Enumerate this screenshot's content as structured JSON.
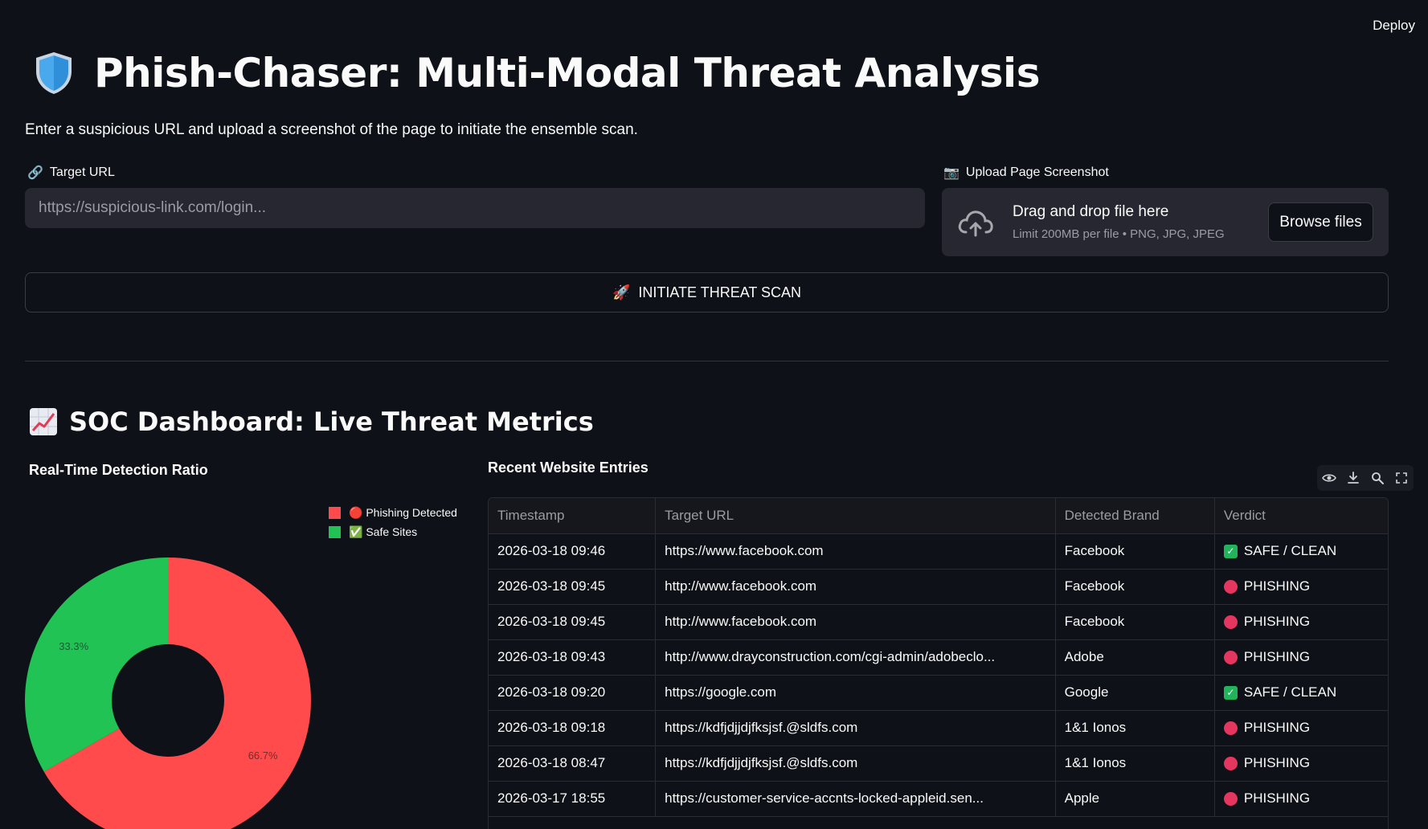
{
  "header": {
    "deploy_label": "Deploy"
  },
  "page": {
    "title": "Phish-Chaser: Multi-Modal Threat Analysis",
    "intro": "Enter a suspicious URL and upload a screenshot of the page to initiate the ensemble scan."
  },
  "url_field": {
    "icon": "link-icon",
    "label": "Target URL",
    "placeholder": "https://suspicious-link.com/login...",
    "value": ""
  },
  "uploader": {
    "icon": "camera-icon",
    "label": "Upload Page Screenshot",
    "drag_text": "Drag and drop file here",
    "limit_text": "Limit 200MB per file • PNG, JPG, JPEG",
    "browse_label": "Browse files"
  },
  "scan_button": {
    "icon": "rocket-icon",
    "label": "INITIATE THREAT SCAN"
  },
  "dashboard": {
    "title": "SOC Dashboard: Live Threat Metrics",
    "icon": "chart-increasing-icon"
  },
  "colors": {
    "phishing": "#ff4b4b",
    "safe": "#21c354",
    "accent_check": "#22b35d",
    "accent_dot": "#e5365f"
  },
  "chart_data": {
    "type": "pie",
    "title": "Real-Time Detection Ratio",
    "donut": true,
    "legend_position": "top-right",
    "categories": [
      "🔴 Phishing Detected",
      "✅ Safe Sites"
    ],
    "values": [
      66.7,
      33.3
    ],
    "labels": [
      "66.7%",
      "33.3%"
    ]
  },
  "table": {
    "title": "Recent Website Entries",
    "toolbar": [
      "eye-icon",
      "download-icon",
      "search-icon",
      "fullscreen-icon"
    ],
    "columns": [
      "Timestamp",
      "Target URL",
      "Detected Brand",
      "Verdict"
    ],
    "rows": [
      {
        "timestamp": "2026-03-18 09:46",
        "url": "https://www.facebook.com",
        "brand": "Facebook",
        "verdict": "SAFE / CLEAN",
        "status": "safe"
      },
      {
        "timestamp": "2026-03-18 09:45",
        "url": "http://www.facebook.com",
        "brand": "Facebook",
        "verdict": "PHISHING",
        "status": "phishing"
      },
      {
        "timestamp": "2026-03-18 09:45",
        "url": "http://www.facebook.com",
        "brand": "Facebook",
        "verdict": "PHISHING",
        "status": "phishing"
      },
      {
        "timestamp": "2026-03-18 09:43",
        "url": "http://www.drayconstruction.com/cgi-admin/adobeclo...",
        "brand": "Adobe",
        "verdict": "PHISHING",
        "status": "phishing"
      },
      {
        "timestamp": "2026-03-18 09:20",
        "url": "https://google.com",
        "brand": "Google",
        "verdict": "SAFE / CLEAN",
        "status": "safe"
      },
      {
        "timestamp": "2026-03-18 09:18",
        "url": "https://kdfjdjjdjfksjsf.@sldfs.com",
        "brand": "1&1 Ionos",
        "verdict": "PHISHING",
        "status": "phishing"
      },
      {
        "timestamp": "2026-03-18 08:47",
        "url": "https://kdfjdjjdjfksjsf.@sldfs.com",
        "brand": "1&1 Ionos",
        "verdict": "PHISHING",
        "status": "phishing"
      },
      {
        "timestamp": "2026-03-17 18:55",
        "url": "https://customer-service-accnts-locked-appleid.sen...",
        "brand": "Apple",
        "verdict": "PHISHING",
        "status": "phishing"
      }
    ]
  }
}
